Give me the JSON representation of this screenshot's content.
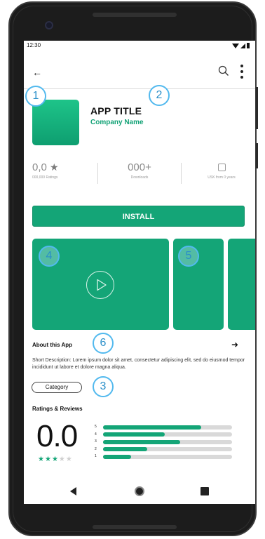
{
  "status_bar": {
    "time": "12:30"
  },
  "app": {
    "title": "APP TITLE",
    "company": "Company Name"
  },
  "stats": {
    "rating_value": "0,0",
    "rating_label": "000,000 Ratings",
    "downloads_value": "000+",
    "downloads_label": "Downloads",
    "age_label": "USK from 0 years"
  },
  "install_label": "INSTALL",
  "about": {
    "title": "About this App",
    "description": "Short Description: Lorem ipsum dolor sit amet, consectetur adipiscing elit, sed do eiusmod tempor incididunt ut labore et dolore magna aliqua."
  },
  "category_label": "Category",
  "ratings": {
    "title": "Ratings & Reviews",
    "score": "0.0",
    "stars_filled": 3,
    "stars_total": 5,
    "distribution": [
      {
        "star": "5",
        "fraction": 0.76
      },
      {
        "star": "4",
        "fraction": 0.48
      },
      {
        "star": "3",
        "fraction": 0.6
      },
      {
        "star": "2",
        "fraction": 0.34
      },
      {
        "star": "1",
        "fraction": 0.22
      }
    ]
  },
  "callouts": [
    "1",
    "2",
    "3",
    "4",
    "5",
    "6"
  ],
  "colors": {
    "accent": "#14a577",
    "company_text": "#12a276",
    "callout_border": "#52b9ee",
    "bar_track": "#d9d9d9"
  },
  "icons": {
    "back": "arrow-left-icon",
    "search": "search-icon",
    "more": "more-vertical-icon",
    "play": "play-icon",
    "about_arrow": "arrow-right-icon",
    "rating_star": "star-icon"
  }
}
